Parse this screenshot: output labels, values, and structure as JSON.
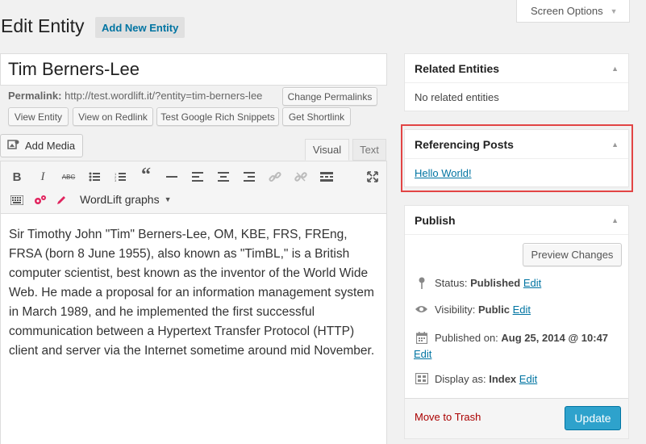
{
  "screen_options": "Screen Options",
  "header": {
    "title": "Edit Entity",
    "add_new": "Add New Entity"
  },
  "entity_title": "Tim Berners-Lee",
  "permalink": {
    "label": "Permalink:",
    "url": "http://test.wordlift.it/?entity=tim-berners-lee",
    "change": "Change Permalinks",
    "view_entity": "View Entity",
    "view_redlink": "View on Redlink",
    "rich_snippets": "Test Google Rich Snippets",
    "shortlink": "Get Shortlink"
  },
  "editor": {
    "add_media": "Add Media",
    "tab_visual": "Visual",
    "tab_text": "Text",
    "toolbar": {
      "bold": "B",
      "italic": "I",
      "strike": "ABC",
      "quote": "“",
      "wordlift_graphs": "WordLift graphs"
    },
    "content": "Sir Timothy John \"Tim\" Berners-Lee, OM, KBE, FRS, FREng, FRSA (born 8 June 1955), also known as \"TimBL,\" is a British computer scientist, best known as the inventor of the World Wide Web. He made a proposal for an information management system in March 1989, and he implemented the first successful communication between a Hypertext Transfer Protocol (HTTP) client and server via the Internet sometime around mid November."
  },
  "related": {
    "title": "Related Entities",
    "empty": "No related entities"
  },
  "referencing": {
    "title": "Referencing Posts",
    "link": "Hello World!"
  },
  "publish": {
    "title": "Publish",
    "preview": "Preview Changes",
    "status_label": "Status:",
    "status_value": "Published",
    "visibility_label": "Visibility:",
    "visibility_value": "Public",
    "published_label": "Published on:",
    "published_value": "Aug 25, 2014 @ 10:47",
    "display_label": "Display as:",
    "display_value": "Index",
    "edit": "Edit",
    "trash": "Move to Trash",
    "update": "Update"
  },
  "colors": {
    "accent": "#2ea2cc",
    "link": "#0074a2",
    "highlight": "#e24545",
    "trash": "#aa0000"
  }
}
